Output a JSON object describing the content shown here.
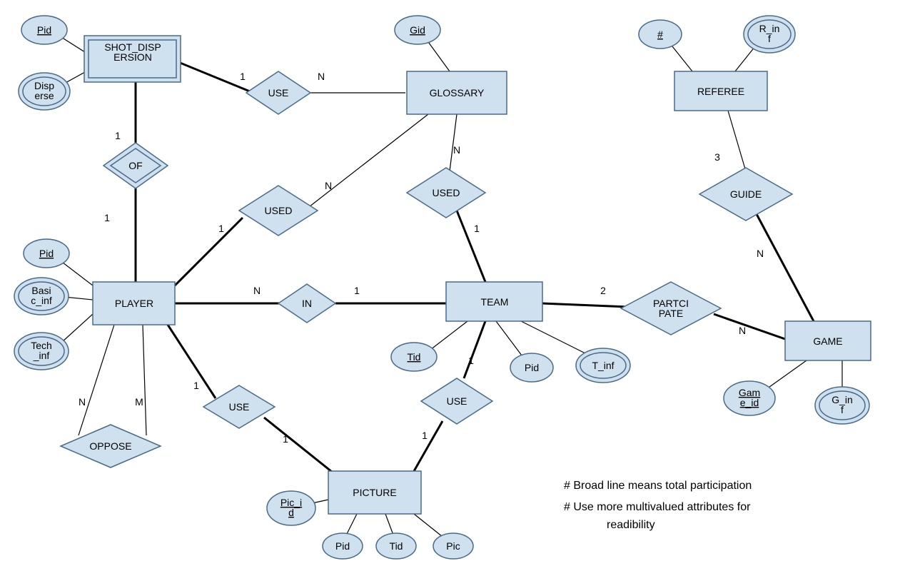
{
  "entities": {
    "shot_dispersion": "SHOT_DISP\nERSION",
    "glossary": "GLOSSARY",
    "referee": "REFEREE",
    "player": "PLAYER",
    "team": "TEAM",
    "game": "GAME",
    "picture": "PICTURE"
  },
  "relationships": {
    "use_sd_gl": "USE",
    "of": "OF",
    "used_pl_gl": "USED",
    "used_tm_gl": "USED",
    "guide": "GUIDE",
    "in": "IN",
    "participate": "PARTCI\nPATE",
    "oppose": "OPPOSE",
    "use_pl_pic": "USE",
    "use_tm_pic": "USE"
  },
  "attributes": {
    "sd_pid": "Pid",
    "sd_disperse": "Disp\nerse",
    "gl_gid": "Gid",
    "ref_num": "#",
    "ref_rinf": "R_in\nf",
    "pl_pid": "Pid",
    "pl_basic": "Basi\nc_inf",
    "pl_tech": "Tech\n_inf",
    "tm_tid": "Tid",
    "tm_pid": "Pid",
    "tm_tinf": "T_inf",
    "gm_gameid": "Gam\ne_id",
    "gm_ginf": "G_in\nf",
    "pic_picid": "Pic_i\nd",
    "pic_pid": "Pid",
    "pic_tid": "Tid",
    "pic_pic": "Pic"
  },
  "cardinalities": {
    "sd_use": "1",
    "gl_use": "N",
    "sd_of": "1",
    "pl_of": "1",
    "pl_used": "1",
    "gl_used_pl": "N",
    "tm_used": "1",
    "gl_used_tm": "N",
    "ref_guide": "3",
    "gm_guide": "N",
    "pl_in": "N",
    "tm_in": "1",
    "tm_part": "2",
    "gm_part": "N",
    "pl_opp_n": "N",
    "pl_opp_m": "M",
    "pl_use_pic": "1",
    "pic_use_pl": "1",
    "tm_use_pic": "1",
    "pic_use_tm": "1"
  },
  "notes": {
    "line1": "# Broad line means  total participation",
    "line2": "# Use more multivalued attributes for",
    "line3": "readibility"
  }
}
